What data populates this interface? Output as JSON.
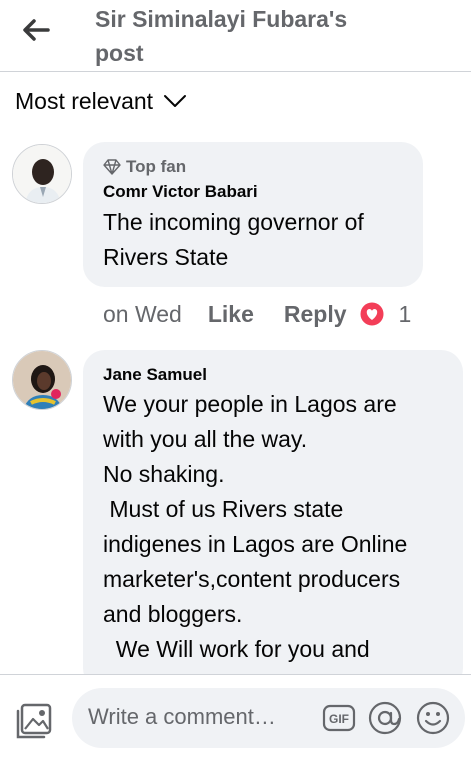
{
  "header": {
    "title": "Sir Siminalayi Fubara's post"
  },
  "sort": {
    "label": "Most relevant"
  },
  "comments": [
    {
      "badge": "Top fan",
      "author": "Comr Victor Babari",
      "text": "The incoming governor of\nRivers State",
      "time": "on Wed",
      "like_label": "Like",
      "reply_label": "Reply",
      "reaction_count": "1"
    },
    {
      "author": "Jane Samuel",
      "text": "We your people in Lagos are\nwith you all the way.\nNo shaking.\n Must of us Rivers state\nindigenes in Lagos are Online\nmarketer's,content producers\nand bloggers.\n  We Will work for you and"
    }
  ],
  "composer": {
    "placeholder": "Write a comment…",
    "gif_label": "GIF"
  },
  "colors": {
    "bubble": "#f0f2f5",
    "secondary_text": "#65676b",
    "love_reaction": "#f33e58"
  }
}
